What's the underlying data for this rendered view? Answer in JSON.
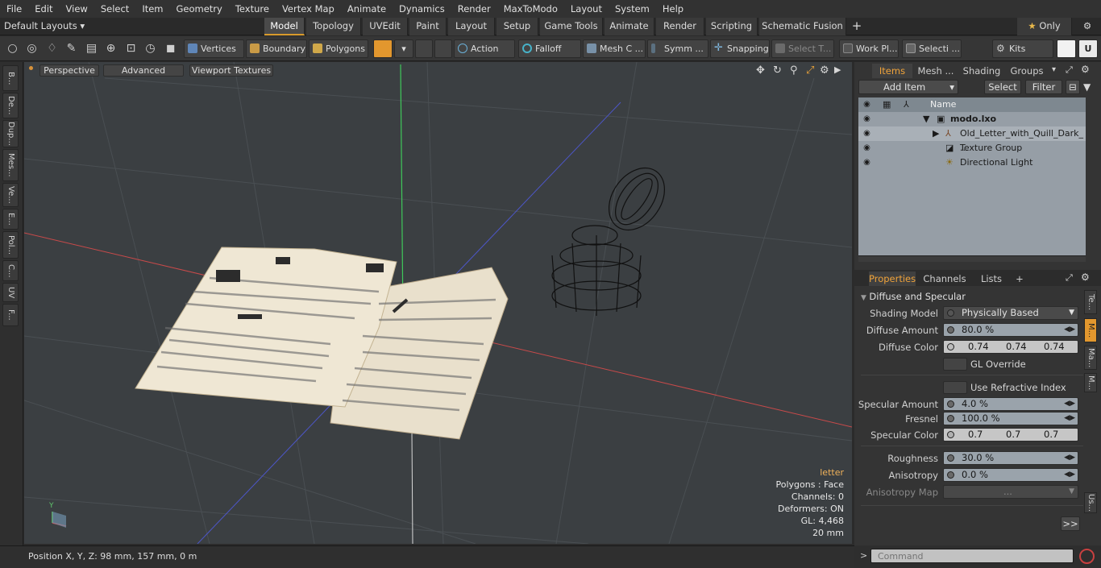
{
  "menu": [
    "File",
    "Edit",
    "View",
    "Select",
    "Item",
    "Geometry",
    "Texture",
    "Vertex Map",
    "Animate",
    "Dynamics",
    "Render",
    "MaxToModo",
    "Layout",
    "System",
    "Help"
  ],
  "layouts": {
    "label": "Default Layouts ▾",
    "tabs": [
      "Model",
      "Topology",
      "UVEdit",
      "Paint",
      "Layout",
      "Setup",
      "Game Tools",
      "Animate",
      "Render",
      "Scripting",
      "Schematic Fusion"
    ],
    "active": "Model",
    "plus": "+",
    "only": "Only"
  },
  "toolbar": {
    "vertices": "Vertices",
    "boundary": "Boundary",
    "polygons": "Polygons",
    "action": "Action",
    "falloff": "Falloff",
    "mesh": "Mesh C ...",
    "symm": "Symm ...",
    "snapping": "Snapping",
    "select_t": "Select T...",
    "work_pl": "Work Pl...",
    "selecti": "Selecti ...",
    "kits": "Kits"
  },
  "left_tools": [
    "B...",
    "De...",
    "Dup...",
    "Mes...",
    "Ve...",
    "E...",
    "Pol...",
    "C...",
    "UV",
    "F..."
  ],
  "viewport": {
    "perspective": "Perspective",
    "advanced": "Advanced",
    "textures": "Viewport Textures"
  },
  "hud": {
    "title": "letter",
    "polygons": "Polygons : Face",
    "channels": "Channels: 0",
    "deformers": "Deformers: ON",
    "gl": "GL: 4,468",
    "scale": "20 mm"
  },
  "axis_label": "Y",
  "status": {
    "position": "Position X, Y, Z:  98 mm, 157 mm, 0 m"
  },
  "items_panel": {
    "tabs": [
      "Items",
      "Mesh ...",
      "Shading",
      "Groups"
    ],
    "add_item": "Add Item",
    "select": "Select",
    "filter": "Filter",
    "col_name": "Name",
    "rows": [
      {
        "label": "modo.lxo"
      },
      {
        "label": "Old_Letter_with_Quill_Dark_ ..."
      },
      {
        "label": "Texture Group"
      },
      {
        "label": "Directional Light"
      }
    ]
  },
  "properties": {
    "tabs": [
      "Properties",
      "Channels",
      "Lists",
      "+"
    ],
    "section": "Diffuse and Specular",
    "shading_model_label": "Shading Model",
    "shading_model": "Physically Based",
    "diffuse_amount_label": "Diffuse Amount",
    "diffuse_amount": "80.0 %",
    "diffuse_color_label": "Diffuse Color",
    "diffuse_color": [
      "0.74",
      "0.74",
      "0.74"
    ],
    "gl_override": "GL Override",
    "refractive": "Use Refractive Index",
    "specular_amount_label": "Specular Amount",
    "specular_amount": "4.0 %",
    "fresnel_label": "Fresnel",
    "fresnel": "100.0 %",
    "specular_color_label": "Specular Color",
    "specular_color": [
      "0.7",
      "0.7",
      "0.7"
    ],
    "roughness_label": "Roughness",
    "roughness": "30.0 %",
    "anisotropy_label": "Anisotropy",
    "anisotropy": "0.0 %",
    "aniso_map_label": "Anisotropy Map",
    "aniso_map": "...",
    "more": ">>",
    "side_tabs": [
      "Te...",
      "M...",
      "Ma...",
      "M...",
      "Us..."
    ]
  },
  "command": {
    "prompt": ">",
    "placeholder": "Command"
  },
  "colors": {
    "accent": "#d89a2c",
    "items_bg": "#969ea6"
  }
}
